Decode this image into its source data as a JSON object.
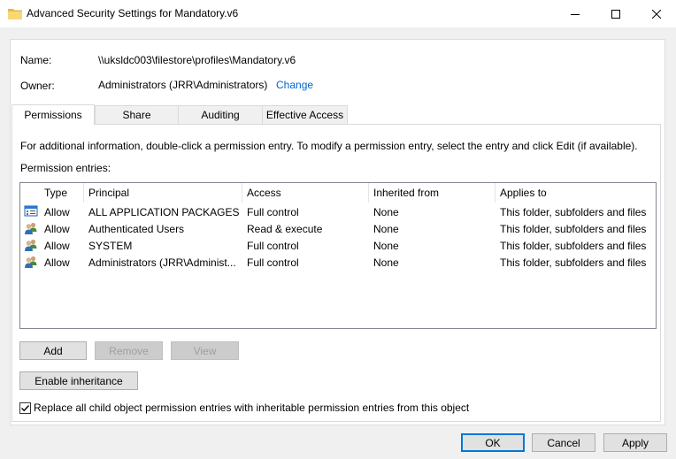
{
  "window": {
    "title": "Advanced Security Settings for Mandatory.v6",
    "icon": "folder-icon"
  },
  "info": {
    "name_label": "Name:",
    "name_value": "\\\\uksldc003\\filestore\\profiles\\Mandatory.v6",
    "owner_label": "Owner:",
    "owner_value": "Administrators (JRR\\Administrators)",
    "change_link": "Change"
  },
  "tabs": [
    {
      "label": "Permissions",
      "active": true
    },
    {
      "label": "Share",
      "active": false
    },
    {
      "label": "Auditing",
      "active": false
    },
    {
      "label": "Effective Access",
      "active": false
    }
  ],
  "permissions": {
    "info_text": "For additional information, double-click a permission entry. To modify a permission entry, select the entry and click Edit (if available).",
    "entries_label": "Permission entries:",
    "columns": [
      "Type",
      "Principal",
      "Access",
      "Inherited from",
      "Applies to"
    ],
    "rows": [
      {
        "icon": "app-packages-icon",
        "type": "Allow",
        "principal": "ALL APPLICATION PACKAGES",
        "access": "Full control",
        "inherited": "None",
        "applies": "This folder, subfolders and files"
      },
      {
        "icon": "users-icon",
        "type": "Allow",
        "principal": "Authenticated Users",
        "access": "Read & execute",
        "inherited": "None",
        "applies": "This folder, subfolders and files"
      },
      {
        "icon": "users-icon",
        "type": "Allow",
        "principal": "SYSTEM",
        "access": "Full control",
        "inherited": "None",
        "applies": "This folder, subfolders and files"
      },
      {
        "icon": "users-icon",
        "type": "Allow",
        "principal": "Administrators (JRR\\Administ...",
        "access": "Full control",
        "inherited": "None",
        "applies": "This folder, subfolders and files"
      }
    ],
    "add_button": "Add",
    "remove_button": "Remove",
    "view_button": "View",
    "enable_inheritance_button": "Enable inheritance",
    "replace_checkbox_label": "Replace all child object permission entries with inheritable permission entries from this object",
    "replace_checked": true
  },
  "footer": {
    "ok": "OK",
    "cancel": "Cancel",
    "apply": "Apply"
  },
  "colors": {
    "link": "#0066cc",
    "default_button_border": "#0078d7",
    "folder": "#e8b84a"
  }
}
